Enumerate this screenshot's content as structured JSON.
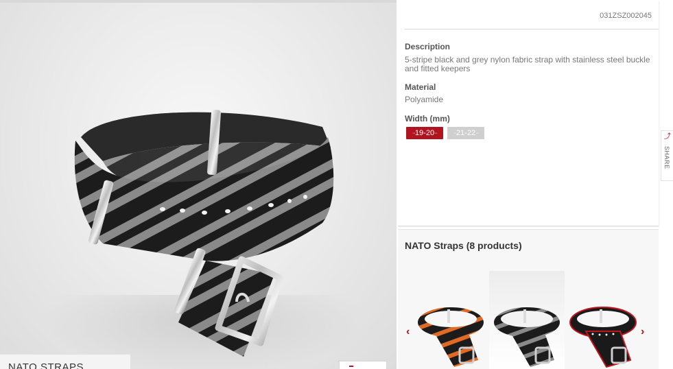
{
  "product": {
    "sku": "031ZSZ002045",
    "caption": "NATO STRAPS",
    "description_label": "Description",
    "description": "5-stripe black and grey nylon fabric strap with stainless steel buckle and fitted keepers",
    "material_label": "Material",
    "material": "Polyamide",
    "width_label": "Width (mm)",
    "widths": [
      {
        "label": "19-20",
        "selected": true
      },
      {
        "label": "21-22",
        "selected": false
      }
    ]
  },
  "share": {
    "label": "SHARE",
    "icon": "share-icon"
  },
  "related": {
    "title": "NATO Straps (8 products)",
    "prev_icon": "chevron-left-icon",
    "next_icon": "chevron-right-icon",
    "items": [
      {
        "name": "orange-black-nato-strap"
      },
      {
        "name": "grey-black-nato-strap"
      },
      {
        "name": "red-black-nato-strap"
      }
    ]
  },
  "colors": {
    "accent": "#b1141f",
    "chip_inactive": "#cfcfcf",
    "strap_black": "#1c1c1c",
    "strap_grey": "#8a8a8a"
  }
}
